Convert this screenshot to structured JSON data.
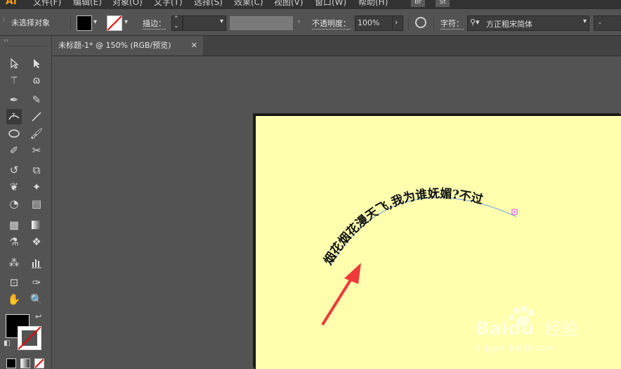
{
  "menubar": {
    "logo": "Ai",
    "items": [
      "文件(F)",
      "编辑(E)",
      "对象(O)",
      "文字(T)",
      "选择(S)",
      "效果(C)",
      "视图(V)",
      "窗口(W)",
      "帮助(H)"
    ],
    "badges": [
      "Br",
      "St"
    ]
  },
  "control_bar": {
    "selection_label": "未选择对象",
    "stroke_label": "描边：",
    "opacity_label": "不透明度：",
    "opacity_value": "100%",
    "character_label": "字符：",
    "font_value": "方正粗宋简体",
    "last_dd": "-",
    "fill_color": "#000000",
    "stroke_color": "none"
  },
  "document_tab": {
    "title": "未标题-1* @ 150% (RGB/预览)",
    "close": "✕"
  },
  "artwork": {
    "path_text": "烟花烟花漫天飞,我为谁妩媚?不过",
    "artboard_color": "#ffffae",
    "arrow_color": "#f03a3a",
    "text_color": "#111111"
  },
  "watermark": {
    "brand": "Baidu",
    "brand_cn": "经验",
    "url": "jingyan.baidu.com"
  }
}
